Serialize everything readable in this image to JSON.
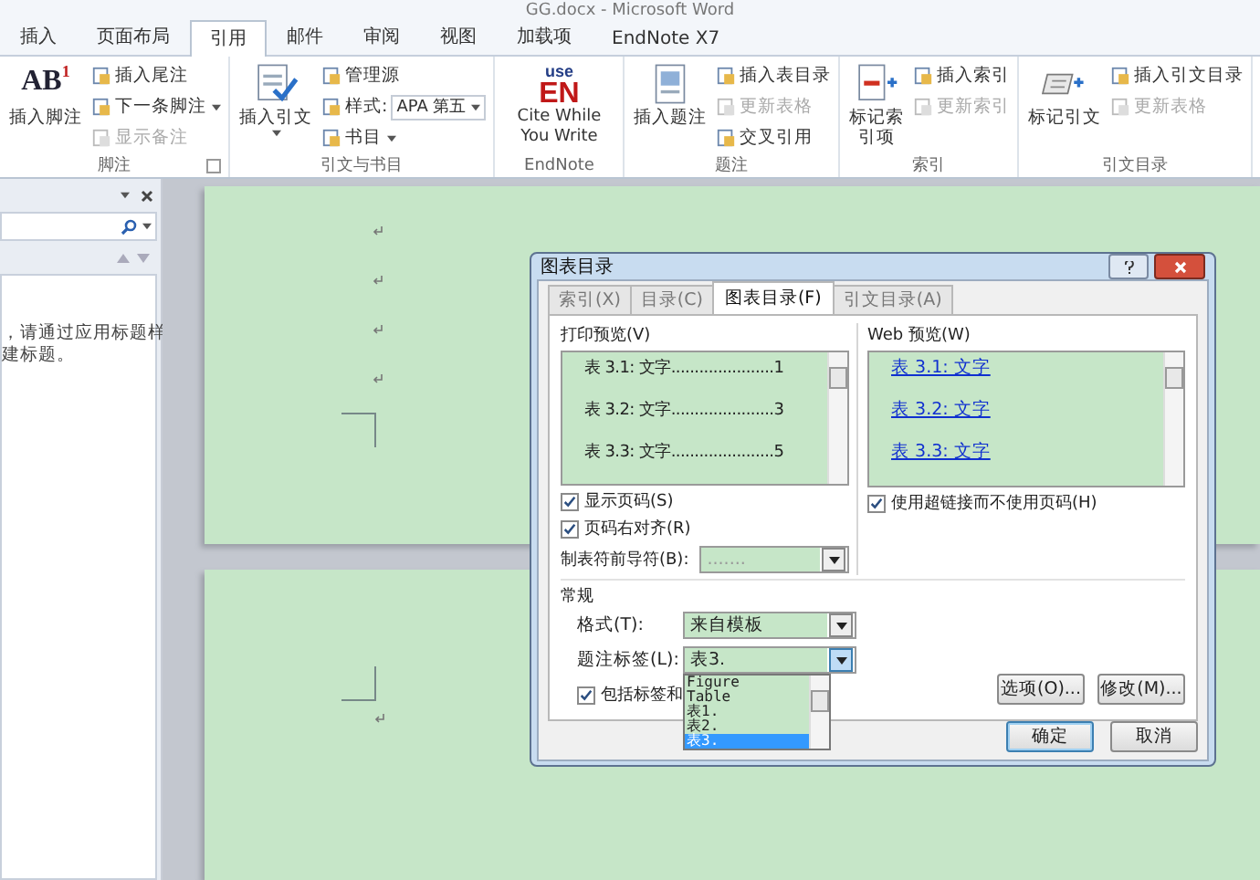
{
  "window": {
    "title": "GG.docx - Microsoft Word"
  },
  "ribbon_tabs": [
    {
      "label": "插入",
      "selected": false
    },
    {
      "label": "页面布局",
      "selected": false
    },
    {
      "label": "引用",
      "selected": true
    },
    {
      "label": "邮件",
      "selected": false
    },
    {
      "label": "审阅",
      "selected": false
    },
    {
      "label": "视图",
      "selected": false
    },
    {
      "label": "加载项",
      "selected": false
    },
    {
      "label": "EndNote X7",
      "selected": false
    }
  ],
  "ribbon_groups": [
    {
      "label": "脚注",
      "launcher": true,
      "large": {
        "label": "插入脚注",
        "icon_text": "AB",
        "icon_sup": "1"
      },
      "small": [
        {
          "label": "插入尾注",
          "disabled": false
        },
        {
          "label": "下一条脚注",
          "disabled": false,
          "dropdown": true
        },
        {
          "label": "显示备注",
          "disabled": true
        }
      ]
    },
    {
      "label": "引文与书目",
      "large": {
        "label": "插入引文",
        "dropdown": true
      },
      "small": [
        {
          "label": "管理源",
          "disabled": false
        },
        {
          "label": "样式:",
          "disabled": false,
          "combo_value": "APA 第五"
        },
        {
          "label": "书目",
          "disabled": false,
          "dropdown": true
        }
      ]
    },
    {
      "label": "EndNote",
      "large": {
        "label": "Cite While You Write",
        "logo_top": "use",
        "logo": "EN"
      }
    },
    {
      "label": "题注",
      "large": {
        "label": "插入题注"
      },
      "small": [
        {
          "label": "插入表目录",
          "disabled": false
        },
        {
          "label": "更新表格",
          "disabled": true
        },
        {
          "label": "交叉引用",
          "disabled": false
        }
      ]
    },
    {
      "label": "索引",
      "large": {
        "label": "标记索引项"
      },
      "small": [
        {
          "label": "插入索引",
          "disabled": false
        },
        {
          "label": "更新索引",
          "disabled": true
        }
      ]
    },
    {
      "label": "引文目录",
      "large": {
        "label": "标记引文"
      },
      "small": [
        {
          "label": "插入引文目录",
          "disabled": false
        },
        {
          "label": "更新表格",
          "disabled": true
        }
      ]
    }
  ],
  "nav_pane": {
    "message_lines": [
      "，请通过应用标题样",
      "建标题。"
    ]
  },
  "dialog": {
    "title": "图表目录",
    "tabs": [
      {
        "label": "索引(X)",
        "selected": false
      },
      {
        "label": "目录(C)",
        "selected": false
      },
      {
        "label": "图表目录(F)",
        "selected": true
      },
      {
        "label": "引文目录(A)",
        "selected": false
      }
    ],
    "print_preview": {
      "label": "打印预览(V)",
      "entries": [
        {
          "caption": "表 3.1: 文字",
          "leader": "......................",
          "page": "1"
        },
        {
          "caption": "表 3.2: 文字",
          "leader": "......................",
          "page": "3"
        },
        {
          "caption": "表 3.3: 文字",
          "leader": "......................",
          "page": "5"
        }
      ]
    },
    "web_preview": {
      "label": "Web 预览(W)",
      "entries": [
        "表 3.1: 文字",
        "表 3.2: 文字",
        "表 3.3: 文字"
      ]
    },
    "print_options": [
      {
        "label": "显示页码(S)",
        "checked": true
      },
      {
        "label": "页码右对齐(R)",
        "checked": true
      }
    ],
    "web_option": {
      "label": "使用超链接而不使用页码(H)",
      "checked": true
    },
    "tab_leader": {
      "label": "制表符前导符(B):",
      "value": ".......",
      "disabled": true
    },
    "general": {
      "title": "常规",
      "format": {
        "label": "格式(T):",
        "value": "来自模板"
      },
      "caption_label": {
        "label": "题注标签(L):",
        "value": "表3.",
        "expanded": true,
        "options": [
          {
            "label": "Figure",
            "selected": false
          },
          {
            "label": "Table",
            "selected": false
          },
          {
            "label": "表1.",
            "selected": false
          },
          {
            "label": "表2.",
            "selected": false
          },
          {
            "label": "表3.",
            "selected": true
          }
        ]
      },
      "include_label": {
        "label": "包括标签和",
        "checked": true
      }
    },
    "side_buttons": [
      "选项(O)...",
      "修改(M)..."
    ],
    "buttons": [
      {
        "label": "确定",
        "kind": "default"
      },
      {
        "label": "取消",
        "kind": "normal"
      }
    ]
  }
}
